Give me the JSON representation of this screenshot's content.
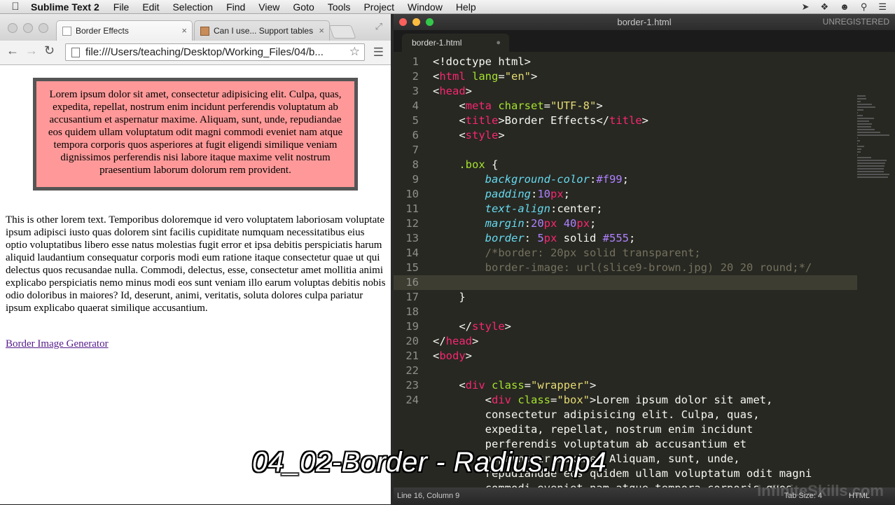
{
  "menubar": {
    "app": "Sublime Text 2",
    "items": [
      "File",
      "Edit",
      "Selection",
      "Find",
      "View",
      "Goto",
      "Tools",
      "Project",
      "Window",
      "Help"
    ]
  },
  "browser": {
    "tabs": [
      {
        "title": "Border Effects",
        "close": "×"
      },
      {
        "title": "Can I use... Support tables",
        "close": "×"
      }
    ],
    "url": "file:///Users/teaching/Desktop/Working_Files/04/b...",
    "box_text": "Lorem ipsum dolor sit amet, consectetur adipisicing elit. Culpa, quas, expedita, repellat, nostrum enim incidunt perferendis voluptatum ab accusantium et aspernatur maxime. Aliquam, sunt, unde, repudiandae eos quidem ullam voluptatum odit magni commodi eveniet nam atque tempora corporis quos asperiores at fugit eligendi similique veniam dignissimos perferendis nisi labore itaque maxime velit nostrum praesentium laborum dolorum rem provident.",
    "other_text": "This is other lorem text. Temporibus doloremque id vero voluptatem laboriosam voluptate ipsum adipisci iusto quas dolorem sint facilis cupiditate numquam necessitatibus eius optio voluptatibus libero esse natus molestias fugit error et ipsa debitis perspiciatis harum aliquid laudantium consequatur corporis modi eum ratione itaque consectetur quae ut qui delectus quos recusandae nulla. Commodi, delectus, esse, consectetur amet mollitia animi explicabo perspiciatis nemo minus modi eos sunt veniam illo earum voluptas debitis nobis odio doloribus in maiores? Id, deserunt, animi, veritatis, soluta dolores culpa pariatur ipsum explicabo quaerat similique accusantium.",
    "link_text": "Border Image Generator"
  },
  "editor": {
    "window_title": "border-1.html",
    "license": "UNREGISTERED",
    "tab_name": "border-1.html",
    "dirty_marker": "●",
    "line_numbers": [
      "1",
      "2",
      "3",
      "4",
      "5",
      "6",
      "7",
      "8",
      "9",
      "10",
      "11",
      "12",
      "13",
      "14",
      "15",
      "16",
      "17",
      "18",
      "19",
      "20",
      "21",
      "22",
      "23",
      "24"
    ],
    "code_lines": [
      [
        [
          "tx",
          "<!doctype html>"
        ]
      ],
      [
        [
          "tx",
          "<"
        ],
        [
          "tg",
          "html"
        ],
        [
          "tx",
          " "
        ],
        [
          "at",
          "lang"
        ],
        [
          "tx",
          "="
        ],
        [
          "st",
          "\"en\""
        ],
        [
          "tx",
          ">"
        ]
      ],
      [
        [
          "tx",
          "<"
        ],
        [
          "tg",
          "head"
        ],
        [
          "tx",
          ">"
        ]
      ],
      [
        [
          "tx",
          "    <"
        ],
        [
          "tg",
          "meta"
        ],
        [
          "tx",
          " "
        ],
        [
          "at",
          "charset"
        ],
        [
          "tx",
          "="
        ],
        [
          "st",
          "\"UTF-8\""
        ],
        [
          "tx",
          ">"
        ]
      ],
      [
        [
          "tx",
          "    <"
        ],
        [
          "tg",
          "title"
        ],
        [
          "tx",
          ">Border Effects</"
        ],
        [
          "tg",
          "title"
        ],
        [
          "tx",
          ">"
        ]
      ],
      [
        [
          "tx",
          "    <"
        ],
        [
          "tg",
          "style"
        ],
        [
          "tx",
          ">"
        ]
      ],
      [
        [
          "tx",
          ""
        ]
      ],
      [
        [
          "tx",
          "    "
        ],
        [
          "sel",
          ".box"
        ],
        [
          "tx",
          " {"
        ]
      ],
      [
        [
          "tx",
          "        "
        ],
        [
          "pr",
          "background-color"
        ],
        [
          "tx",
          ":"
        ],
        [
          "nm",
          "#f99"
        ],
        [
          "tx",
          ";"
        ]
      ],
      [
        [
          "tx",
          "        "
        ],
        [
          "pr",
          "padding"
        ],
        [
          "tx",
          ":"
        ],
        [
          "nm",
          "10"
        ],
        [
          "un",
          "px"
        ],
        [
          "tx",
          ";"
        ]
      ],
      [
        [
          "tx",
          "        "
        ],
        [
          "pr",
          "text-align"
        ],
        [
          "tx",
          ":center;"
        ]
      ],
      [
        [
          "tx",
          "        "
        ],
        [
          "pr",
          "margin"
        ],
        [
          "tx",
          ":"
        ],
        [
          "nm",
          "20"
        ],
        [
          "un",
          "px"
        ],
        [
          "tx",
          " "
        ],
        [
          "nm",
          "40"
        ],
        [
          "un",
          "px"
        ],
        [
          "tx",
          ";"
        ]
      ],
      [
        [
          "tx",
          "        "
        ],
        [
          "pr",
          "border"
        ],
        [
          "tx",
          ": "
        ],
        [
          "nm",
          "5"
        ],
        [
          "un",
          "px"
        ],
        [
          "tx",
          " solid "
        ],
        [
          "nm",
          "#555"
        ],
        [
          "tx",
          ";"
        ]
      ],
      [
        [
          "cm",
          "        /*border: 20px solid transparent;"
        ]
      ],
      [
        [
          "cm",
          "        border-image: url(slice9-brown.jpg) 20 20 round;*/"
        ]
      ],
      [
        [
          "tx",
          ""
        ]
      ],
      [
        [
          "tx",
          "    }"
        ]
      ],
      [
        [
          "tx",
          ""
        ]
      ],
      [
        [
          "tx",
          "    </"
        ],
        [
          "tg",
          "style"
        ],
        [
          "tx",
          ">"
        ]
      ],
      [
        [
          "tx",
          "</"
        ],
        [
          "tg",
          "head"
        ],
        [
          "tx",
          ">"
        ]
      ],
      [
        [
          "tx",
          "<"
        ],
        [
          "tg",
          "body"
        ],
        [
          "tx",
          ">"
        ]
      ],
      [
        [
          "tx",
          ""
        ]
      ],
      [
        [
          "tx",
          "    <"
        ],
        [
          "tg",
          "div"
        ],
        [
          "tx",
          " "
        ],
        [
          "at",
          "class"
        ],
        [
          "tx",
          "="
        ],
        [
          "st",
          "\"wrapper\""
        ],
        [
          "tx",
          ">"
        ]
      ],
      [
        [
          "tx",
          "        <"
        ],
        [
          "tg",
          "div"
        ],
        [
          "tx",
          " "
        ],
        [
          "at",
          "class"
        ],
        [
          "tx",
          "="
        ],
        [
          "st",
          "\"box\""
        ],
        [
          "tx",
          ">Lorem ipsum dolor sit amet,"
        ]
      ],
      [
        [
          "tx",
          "        consectetur adipisicing elit. Culpa, quas,"
        ]
      ],
      [
        [
          "tx",
          "        expedita, repellat, nostrum enim incidunt"
        ]
      ],
      [
        [
          "tx",
          "        perferendis voluptatum ab accusantium et"
        ]
      ],
      [
        [
          "tx",
          "        aspernatur maxime. Aliquam, sunt, unde,"
        ]
      ],
      [
        [
          "tx",
          "        repudiandae eos quidem ullam voluptatum odit magni"
        ]
      ],
      [
        [
          "tx",
          "        commodi eveniet nam atque tempora corporis quos"
        ]
      ]
    ],
    "status_position": "Line 16, Column 9",
    "tab_size": "Tab Size: 4",
    "syntax": "HTML"
  },
  "overlay": {
    "caption": "04_02-Border - Radius.mp4",
    "watermark": "InfiniteSkills.com"
  },
  "colors": {
    "box_bg": "#f99",
    "box_border": "#555",
    "editor_bg": "#272822",
    "tag": "#f92672",
    "string": "#e6db74",
    "attribute": "#a6e22e",
    "property": "#66d9ef",
    "number": "#ae81ff",
    "comment": "#75715e"
  }
}
